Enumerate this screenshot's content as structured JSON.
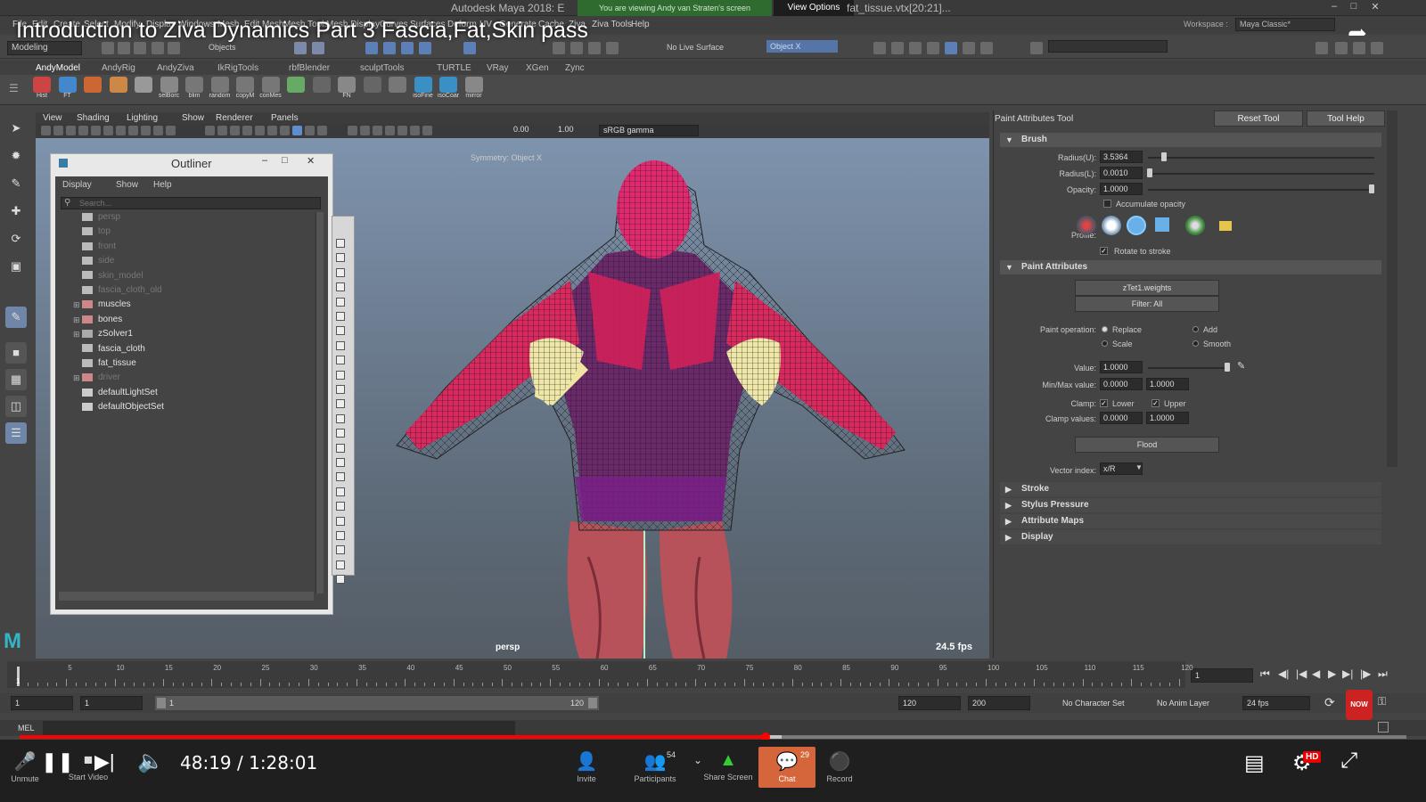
{
  "video": {
    "title": "Introduction to Ziva Dynamics Part 3 Fascia,Fat,Skin pass",
    "time": "48:19 / 1:28:01",
    "progress_fraction": 0.538
  },
  "window": {
    "app_title": "Autodesk Maya 2018: E",
    "share_banner": "You are viewing Andy van Straten's screen",
    "view_options": "View Options",
    "file_title": "fat_tissue.vtx[20:21]..."
  },
  "menubar": {
    "items": [
      "File",
      "Edit",
      "Create",
      "Select",
      "Modify",
      "Display",
      "Windows",
      "Mesh",
      "Edit Mesh",
      "Mesh Tools",
      "Mesh Display",
      "Curves",
      "Surfaces",
      "Deform",
      "UV",
      "Generate",
      "Cache",
      "Ziva",
      "Ziva Tools",
      "Help"
    ],
    "workspace_label": "Workspace :",
    "workspace_value": "Maya Classic*"
  },
  "statusline": {
    "mode": "Modeling",
    "objects_label": "Objects",
    "live_surface": "No Live Surface",
    "object_field": "Object X"
  },
  "shelf": {
    "tabs": [
      "AndyModel",
      "AndyRig",
      "AndyZiva",
      "IkRigTools",
      "rbfBlender",
      "sculptTools",
      "TURTLE",
      "VRay",
      "XGen",
      "Zync"
    ],
    "buttons": [
      "Hist",
      "FT",
      "",
      "",
      "",
      "selBorc",
      "blim",
      "random",
      "copyM",
      "conMes",
      "",
      "",
      "FN",
      "",
      "",
      "isoFine",
      "isoCoar",
      "mirror"
    ]
  },
  "viewport": {
    "menu": [
      "View",
      "Shading",
      "Lighting",
      "Show",
      "Renderer",
      "Panels"
    ],
    "field_a": "0.00",
    "field_b": "1.00",
    "gamma": "sRGB gamma",
    "hud_top": "Symmetry: Object X",
    "camera": "persp",
    "fps": "24.5 fps"
  },
  "outliner": {
    "title": "Outliner",
    "menu": [
      "Display",
      "Show",
      "Help"
    ],
    "search_placeholder": "Search...",
    "rows": [
      {
        "label": "persp",
        "state": "dim",
        "icon": "camera"
      },
      {
        "label": "top",
        "state": "dim",
        "icon": "camera"
      },
      {
        "label": "front",
        "state": "dim",
        "icon": "camera"
      },
      {
        "label": "side",
        "state": "dim",
        "icon": "camera"
      },
      {
        "label": "skin_model",
        "state": "dim",
        "icon": "mesh"
      },
      {
        "label": "fascia_cloth_old",
        "state": "dim",
        "icon": "mesh"
      },
      {
        "label": "muscles",
        "state": "hi",
        "icon": "group",
        "expand": true
      },
      {
        "label": "bones",
        "state": "hi",
        "icon": "group",
        "expand": true
      },
      {
        "label": "zSolver1",
        "state": "hi",
        "icon": "solver",
        "expand": true
      },
      {
        "label": "fascia_cloth",
        "state": "hi",
        "icon": "mesh"
      },
      {
        "label": "fat_tissue",
        "state": "hi",
        "icon": "mesh"
      },
      {
        "label": "driver",
        "state": "dim",
        "icon": "group",
        "expand": true
      },
      {
        "label": "defaultLightSet",
        "state": "hi",
        "icon": "set"
      },
      {
        "label": "defaultObjectSet",
        "state": "hi",
        "icon": "set"
      }
    ]
  },
  "tool": {
    "title": "Paint Attributes Tool",
    "reset": "Reset Tool",
    "help": "Tool Help",
    "brush": {
      "header": "Brush",
      "radius_u_label": "Radius(U):",
      "radius_u": "3.5364",
      "radius_l_label": "Radius(L):",
      "radius_l": "0.0010",
      "opacity_label": "Opacity:",
      "opacity": "1.0000",
      "accumulate": "Accumulate opacity",
      "profile_label": "Profile:",
      "rotate": "Rotate to stroke"
    },
    "paint": {
      "header": "Paint Attributes",
      "attr": "zTet1.weights",
      "filter": "Filter: All",
      "operation_label": "Paint operation:",
      "ops": [
        "Replace",
        "Add",
        "Scale",
        "Smooth"
      ],
      "value_label": "Value:",
      "value": "1.0000",
      "minmax_label": "Min/Max value:",
      "min": "0.0000",
      "max": "1.0000",
      "clamp_label": "Clamp:",
      "lower": "Lower",
      "upper": "Upper",
      "clampvals_label": "Clamp values:",
      "clamp_min": "0.0000",
      "clamp_max": "1.0000",
      "flood": "Flood",
      "vector_label": "Vector index:",
      "vector": "x/R"
    },
    "collapsed": [
      "Stroke",
      "Stylus Pressure",
      "Attribute Maps",
      "Display"
    ]
  },
  "timeline": {
    "ticks": [
      "5",
      "10",
      "15",
      "20",
      "25",
      "30",
      "35",
      "40",
      "45",
      "50",
      "55",
      "60",
      "65",
      "70",
      "75",
      "80",
      "85",
      "90",
      "95",
      "100",
      "105",
      "110",
      "115",
      "120"
    ],
    "current": "1",
    "frame_field": "1",
    "range_start": "1",
    "range_inner_start": "1",
    "range_inner_left": "1",
    "range_inner_right": "120",
    "range_end": "120",
    "anim_end": "200",
    "character_set": "No Character Set",
    "anim_layer": "No Anim Layer",
    "fps": "24 fps",
    "mel": "MEL"
  },
  "zoom": {
    "unmute": "Unmute",
    "start_video": "Start Video",
    "invite": "Invite",
    "participants": "Participants",
    "participants_count": "54",
    "share": "Share Screen",
    "chat": "Chat",
    "chat_count": "29",
    "record": "Record",
    "hd": "HD",
    "badge": "NOW"
  }
}
